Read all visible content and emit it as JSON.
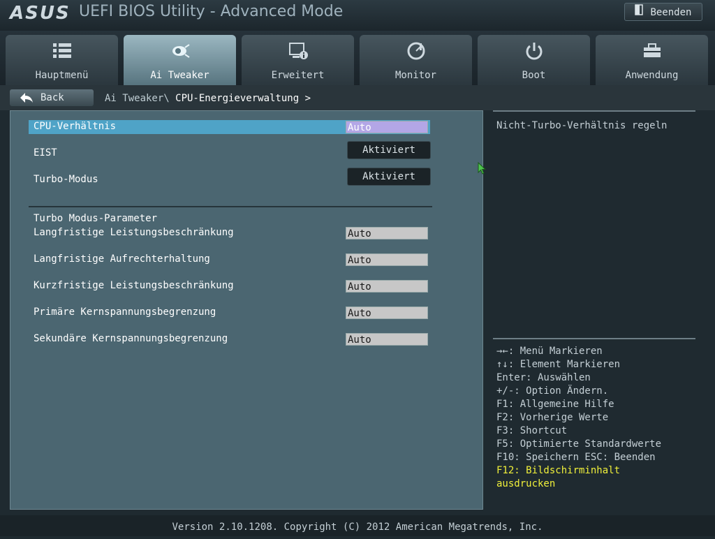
{
  "header": {
    "brand": "ASUS",
    "title": "UEFI BIOS Utility - Advanced Mode",
    "exit_label": "Beenden"
  },
  "tabs": [
    {
      "label": "Hauptmenü",
      "icon": "list-icon",
      "active": false
    },
    {
      "label": "Ai Tweaker",
      "icon": "ai-tweaker-icon",
      "active": true
    },
    {
      "label": "Erweitert",
      "icon": "advanced-icon",
      "active": false
    },
    {
      "label": "Monitor",
      "icon": "monitor-gauge-icon",
      "active": false
    },
    {
      "label": "Boot",
      "icon": "power-icon",
      "active": false
    },
    {
      "label": "Anwendung",
      "icon": "toolbox-icon",
      "active": false
    }
  ],
  "subheader": {
    "back_label": "Back",
    "breadcrumb_parent": "Ai Tweaker\\",
    "breadcrumb_current": " CPU-Energieverwaltung >"
  },
  "settings": [
    {
      "label": "CPU-Verhältnis",
      "value": "Auto"
    },
    {
      "label": "EIST",
      "value": "Aktiviert"
    },
    {
      "label": "Turbo-Modus",
      "value": "Aktiviert"
    }
  ],
  "turbo_section": {
    "title": "Turbo Modus-Parameter",
    "items": [
      {
        "label": "Langfristige Leistungsbeschränkung",
        "value": "Auto"
      },
      {
        "label": "Langfristige Aufrechterhaltung",
        "value": "Auto"
      },
      {
        "label": "Kurzfristige Leistungsbeschränkung",
        "value": "Auto"
      },
      {
        "label": "Primäre Kernspannungsbegrenzung",
        "value": "Auto"
      },
      {
        "label": "Sekundäre Kernspannungsbegrenzung",
        "value": "Auto"
      }
    ]
  },
  "help": {
    "text": "Nicht-Turbo-Verhältnis regeln"
  },
  "keys": [
    "→←: Menü Markieren",
    "↑↓: Element Markieren",
    "Enter: Auswählen",
    "+/-: Option Ändern.",
    "F1: Allgemeine Hilfe",
    "F2: Vorherige Werte",
    "F3: Shortcut",
    "F5: Optimierte Standardwerte",
    "F10: Speichern  ESC: Beenden",
    "F12: Bildschirminhalt",
    "ausdrucken"
  ],
  "footer": {
    "version": "Version 2.10.1208. Copyright (C) 2012 American Megatrends, Inc."
  },
  "colors": {
    "selected_row": "#4fa3c7",
    "selected_value": "#b3a6e6",
    "highlight_key": "#f0f03a",
    "active_tab": "#9bb7c1"
  }
}
